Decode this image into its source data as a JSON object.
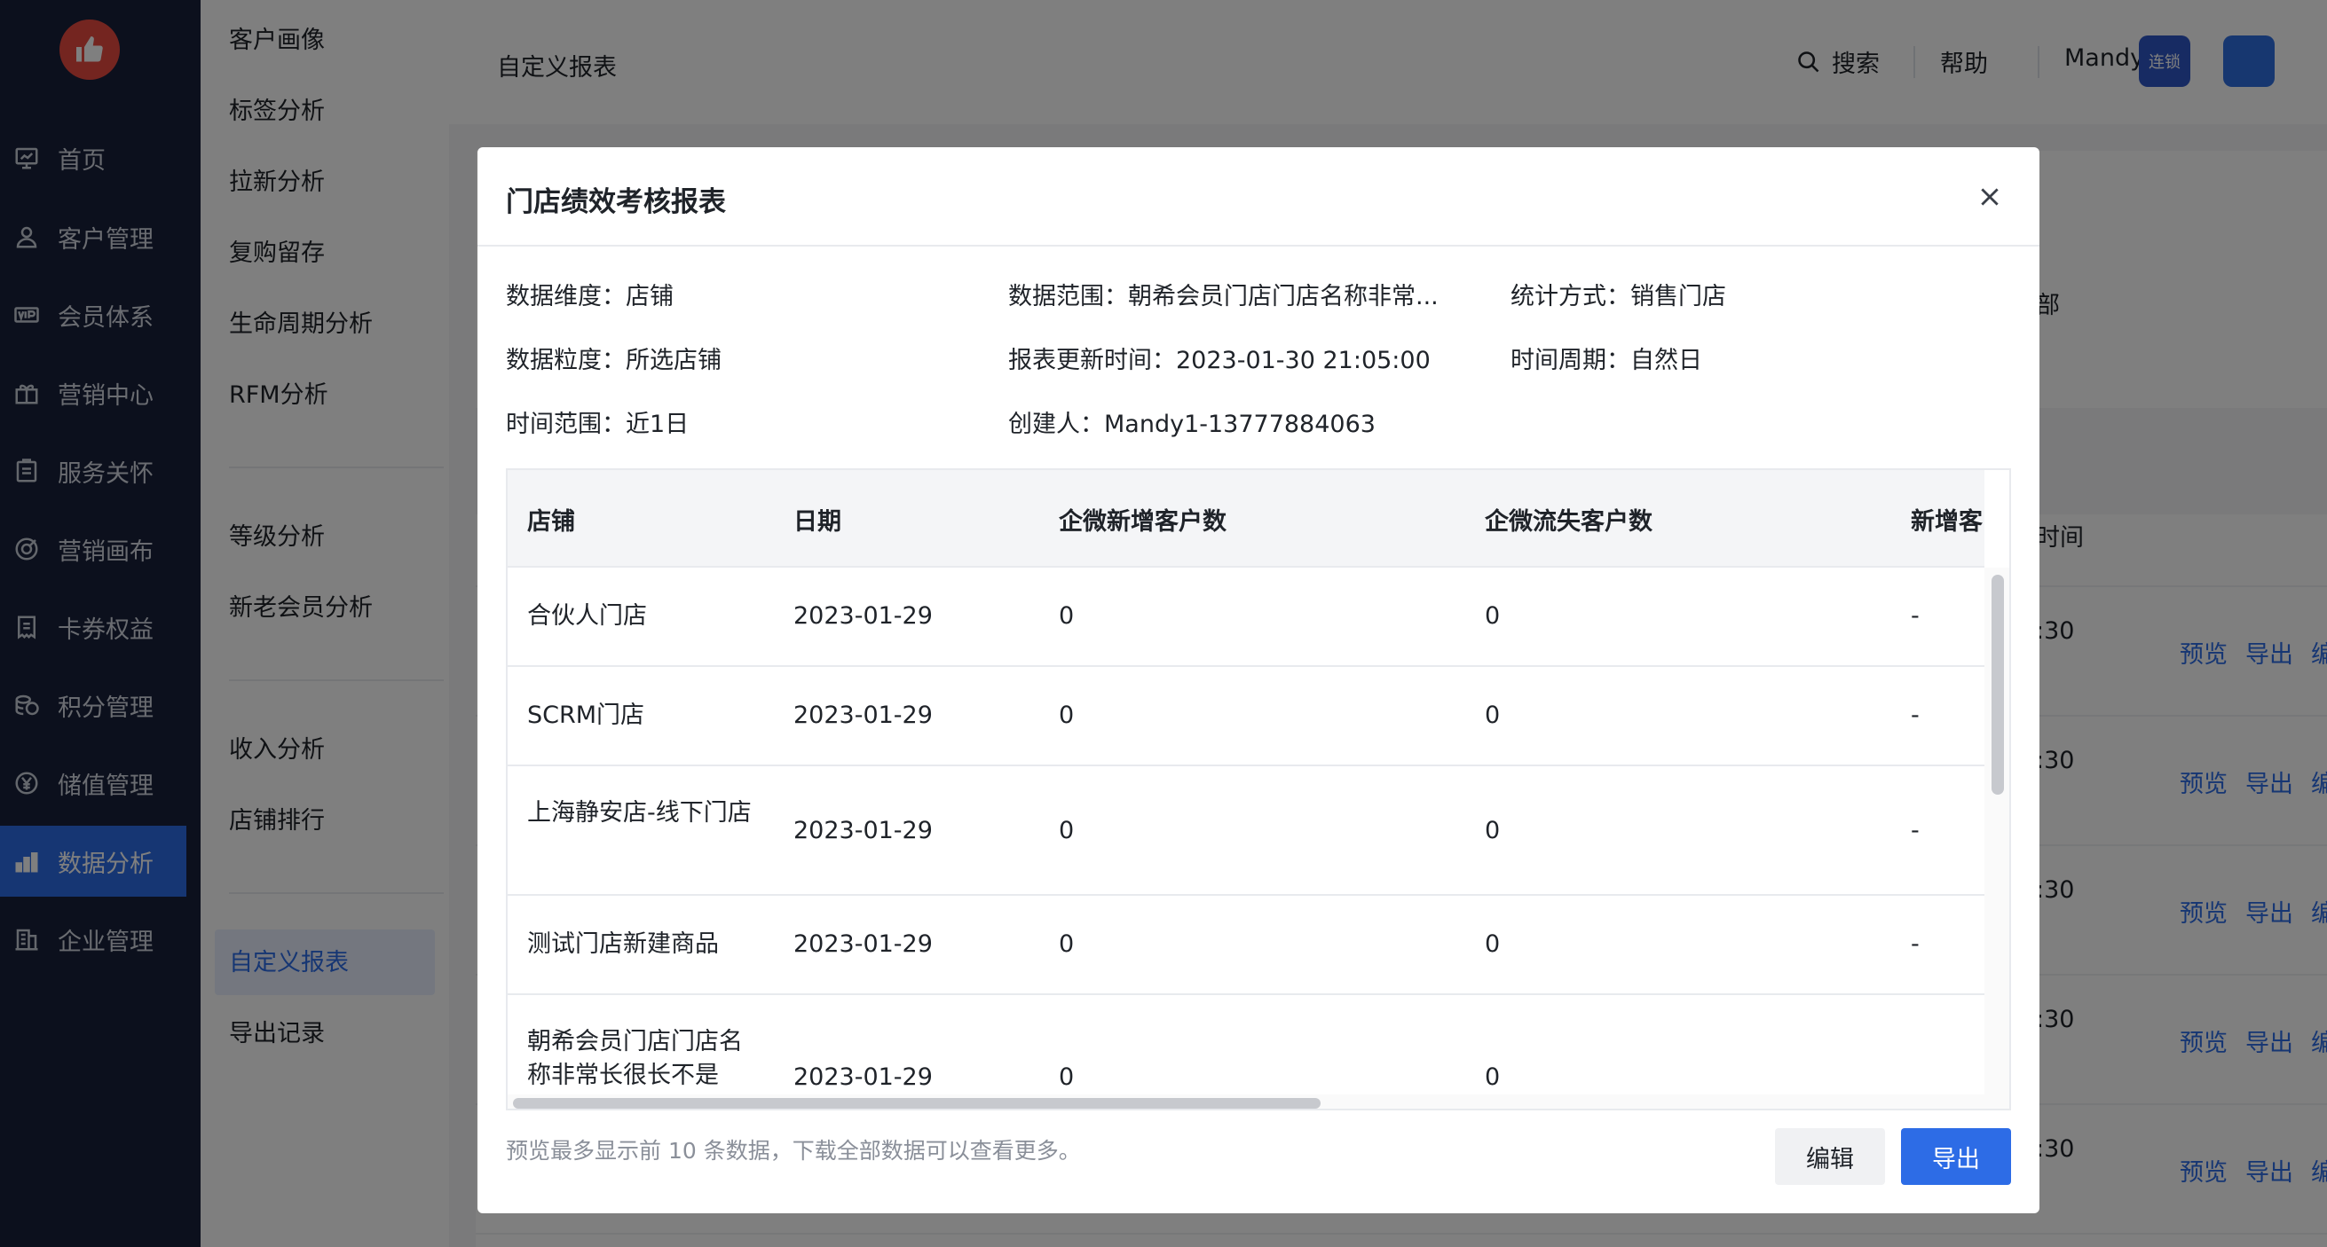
{
  "sidebar": {
    "items": [
      {
        "label": "首页",
        "icon": "dashboard-icon"
      },
      {
        "label": "客户管理",
        "icon": "user-icon"
      },
      {
        "label": "会员体系",
        "icon": "vip-icon"
      },
      {
        "label": "营销中心",
        "icon": "gift-icon"
      },
      {
        "label": "服务关怀",
        "icon": "clipboard-icon"
      },
      {
        "label": "营销画布",
        "icon": "canvas-icon"
      },
      {
        "label": "卡券权益",
        "icon": "coupon-icon"
      },
      {
        "label": "积分管理",
        "icon": "coins-icon"
      },
      {
        "label": "储值管理",
        "icon": "yen-icon"
      },
      {
        "label": "数据分析",
        "icon": "bar-chart-icon",
        "active": true
      },
      {
        "label": "企业管理",
        "icon": "building-icon"
      }
    ]
  },
  "submenu": {
    "items": [
      "客户画像",
      "标签分析",
      "拉新分析",
      "复购留存",
      "生命周期分析",
      "RFM分析",
      "等级分析",
      "新老会员分析",
      "收入分析",
      "店铺排行",
      "自定义报表",
      "导出记录"
    ],
    "active": "自定义报表"
  },
  "header": {
    "title": "自定义报表",
    "search_label": "搜索",
    "help_label": "帮助",
    "user_label": "Mandy1",
    "app_badge_label": "连锁"
  },
  "background_rows": [
    {
      "time": ":30",
      "actions": [
        "预览",
        "导出",
        "编"
      ]
    },
    {
      "time": ":30",
      "actions": [
        "预览",
        "导出",
        "编"
      ]
    },
    {
      "time": ":30",
      "actions": [
        "预览",
        "导出",
        "编"
      ]
    },
    {
      "time": ":30",
      "actions": [
        "预览",
        "导出",
        "编"
      ]
    },
    {
      "time": ":30",
      "actions": [
        "预览",
        "导出",
        "编"
      ]
    }
  ],
  "background_header_fragment": "时间",
  "background_misc_fragment": "部",
  "modal": {
    "title": "门店绩效考核报表",
    "meta": {
      "dimension": "数据维度：店铺",
      "scope": "数据范围：朝希会员门店门店名称非常...",
      "stat_method": "统计方式：销售门店",
      "granularity": "数据粒度：所选店铺",
      "updated": "报表更新时间：2023-01-30 21:05:00",
      "period": "时间周期：自然日",
      "time_range": "时间范围：近1日",
      "creator": "创建人：Mandy1-13777884063"
    },
    "table": {
      "headers": [
        "店铺",
        "日期",
        "企微新增客户数",
        "企微流失客户数",
        "新增客"
      ],
      "rows": [
        [
          "合伙人门店",
          "2023-01-29",
          "0",
          "0",
          "-"
        ],
        [
          "SCRM门店",
          "2023-01-29",
          "0",
          "0",
          "-"
        ],
        [
          "上海静安店-线下门店",
          "2023-01-29",
          "0",
          "0",
          "-"
        ],
        [
          "测试门店新建商品",
          "2023-01-29",
          "0",
          "0",
          "-"
        ],
        [
          "朝希会员门店门店名称非常长很长不是",
          "2023-01-29",
          "0",
          "0",
          ""
        ]
      ]
    },
    "footer_note": "预览最多显示前 10 条数据，下载全部数据可以查看更多。",
    "edit_label": "编辑",
    "export_label": "导出"
  }
}
